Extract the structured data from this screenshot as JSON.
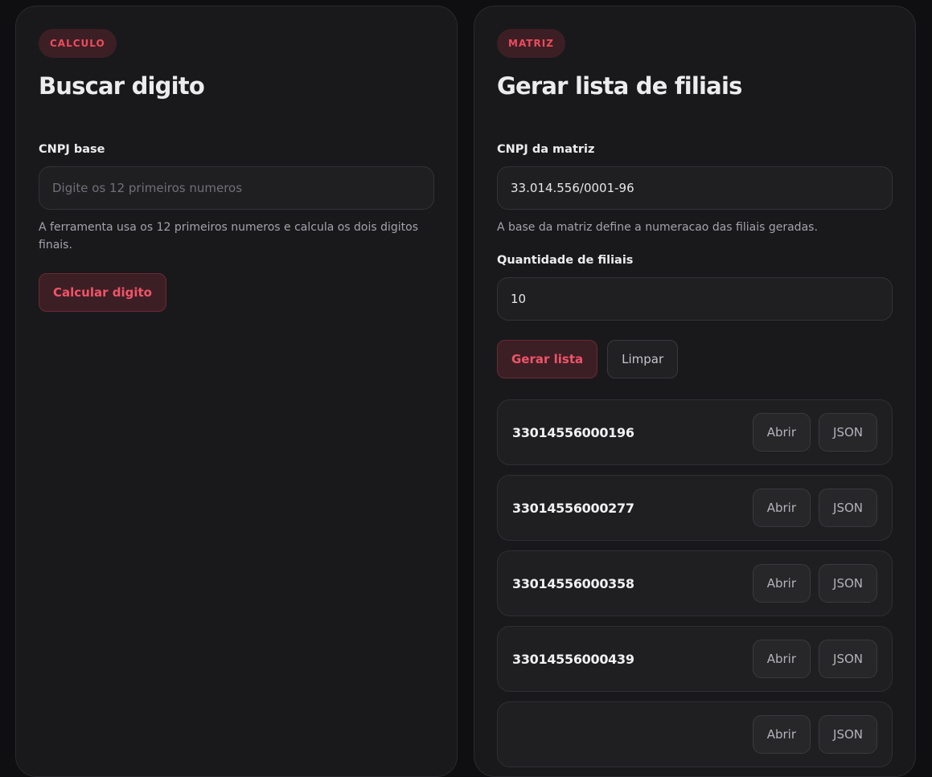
{
  "left": {
    "badge": "CALCULO",
    "title": "Buscar digito",
    "field_label": "CNPJ base",
    "field_placeholder": "Digite os 12 primeiros numeros",
    "help": "A ferramenta usa os 12 primeiros numeros e calcula os dois digitos finais.",
    "button": "Calcular digito"
  },
  "right": {
    "badge": "MATRIZ",
    "title": "Gerar lista de filiais",
    "cnpj_label": "CNPJ da matriz",
    "cnpj_value": "33.014.556/0001-96",
    "cnpj_help": "A base da matriz define a numeracao das filiais geradas.",
    "qty_label": "Quantidade de filiais",
    "qty_value": "10",
    "generate_button": "Gerar lista",
    "clear_button": "Limpar",
    "results": [
      {
        "cnpj": "33014556000196",
        "open": "Abrir",
        "json": "JSON"
      },
      {
        "cnpj": "33014556000277",
        "open": "Abrir",
        "json": "JSON"
      },
      {
        "cnpj": "33014556000358",
        "open": "Abrir",
        "json": "JSON"
      },
      {
        "cnpj": "33014556000439",
        "open": "Abrir",
        "json": "JSON"
      },
      {
        "cnpj": "",
        "open": "Abrir",
        "json": "JSON"
      }
    ]
  },
  "colors": {
    "accent": "#ef4b5c",
    "badge_bg": "#3c1f25",
    "panel_bg": "#19191c",
    "page_bg": "#0f0f11"
  }
}
